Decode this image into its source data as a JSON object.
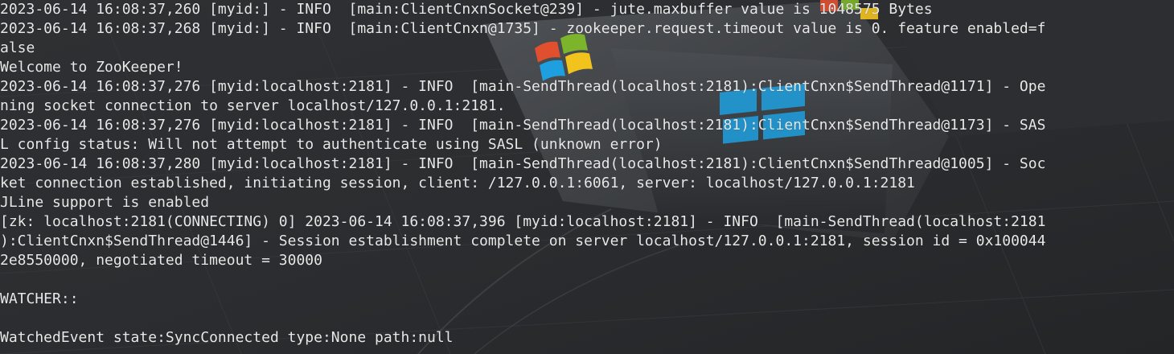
{
  "window": {
    "type": "terminal",
    "wallpaper_icon": "windows-logo-wallpaper"
  },
  "colors": {
    "text": "#e8e8e8",
    "background": "#2a2c2f",
    "logo_red": "#e0502f",
    "logo_green": "#7cb52c",
    "logo_blue": "#1ea0e0",
    "logo_yellow": "#f2c21d"
  },
  "terminal": {
    "lines": [
      "2023-06-14 16:08:37,260 [myid:] - INFO  [main:ClientCnxnSocket@239] - jute.maxbuffer value is 1048575 Bytes",
      "2023-06-14 16:08:37,268 [myid:] - INFO  [main:ClientCnxn@1735] - zookeeper.request.timeout value is 0. feature enabled=f",
      "alse",
      "Welcome to ZooKeeper!",
      "2023-06-14 16:08:37,276 [myid:localhost:2181] - INFO  [main-SendThread(localhost:2181):ClientCnxn$SendThread@1171] - Ope",
      "ning socket connection to server localhost/127.0.0.1:2181.",
      "2023-06-14 16:08:37,276 [myid:localhost:2181] - INFO  [main-SendThread(localhost:2181):ClientCnxn$SendThread@1173] - SAS",
      "L config status: Will not attempt to authenticate using SASL (unknown error)",
      "2023-06-14 16:08:37,280 [myid:localhost:2181] - INFO  [main-SendThread(localhost:2181):ClientCnxn$SendThread@1005] - Soc",
      "ket connection established, initiating session, client: /127.0.0.1:6061, server: localhost/127.0.0.1:2181",
      "JLine support is enabled",
      "[zk: localhost:2181(CONNECTING) 0] 2023-06-14 16:08:37,396 [myid:localhost:2181] - INFO  [main-SendThread(localhost:2181",
      "):ClientCnxn$SendThread@1446] - Session establishment complete on server localhost/127.0.0.1:2181, session id = 0x100044",
      "2e8550000, negotiated timeout = 30000",
      "",
      "WATCHER::",
      "",
      "WatchedEvent state:SyncConnected type:None path:null"
    ]
  }
}
